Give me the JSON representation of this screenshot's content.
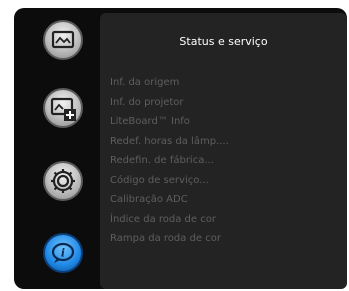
{
  "sidebar": {
    "icons": [
      {
        "name": "source-info-icon",
        "active": false
      },
      {
        "name": "projector-add-icon",
        "active": false
      },
      {
        "name": "settings-gear-icon",
        "active": false
      },
      {
        "name": "info-status-icon",
        "active": true
      }
    ]
  },
  "panel": {
    "title": "Status e serviço",
    "items": [
      "Inf. da origem",
      "Inf. do projetor",
      "LiteBoard™ Info",
      "Redef. horas da lâmp....",
      "Redefin. de fábrica...",
      "Código de serviço...",
      "Calibração ADC",
      "Índice da roda de cor",
      "Rampa da roda de cor"
    ]
  },
  "colors": {
    "background": "#0c0c0c",
    "panel": "#232323",
    "title_text": "#ffffff",
    "item_text": "#5e5e5e",
    "active_icon": "#1e88e5"
  }
}
